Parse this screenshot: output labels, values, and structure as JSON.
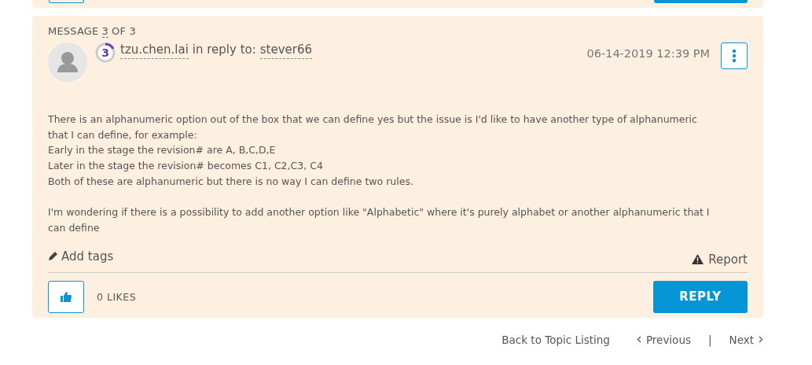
{
  "message": {
    "counter": {
      "prefix": "MESSAGE",
      "number": "3",
      "suffix": "OF 3"
    },
    "author": {
      "rank": "3",
      "name": "tzu.chen.lai",
      "reply_label": "in reply to:",
      "reply_to": "stever66"
    },
    "timestamp": "06-14-2019 12:39 PM",
    "body": [
      "There is an alphanumeric option out of the box that we can define yes but the issue is I'd like to have another type of alphanumeric that I can define, for example:\nEarly in the stage the revision# are A, B,C,D,E\nLater in the stage the revision# becomes C1, C2,C3, C4\nBoth of these are alphanumeric but there is no way I can define two rules.",
      "I'm wondering if there is a possibility to add another option like \"Alphabetic\" where it's purely alphabet or another alphanumeric that I can define"
    ],
    "add_tags": "Add tags",
    "report": "Report",
    "likes": "0 LIKES",
    "reply_button": "REPLY"
  },
  "pagination": {
    "back": "Back to Topic Listing",
    "previous": "Previous",
    "separator": "|",
    "next": "Next"
  }
}
